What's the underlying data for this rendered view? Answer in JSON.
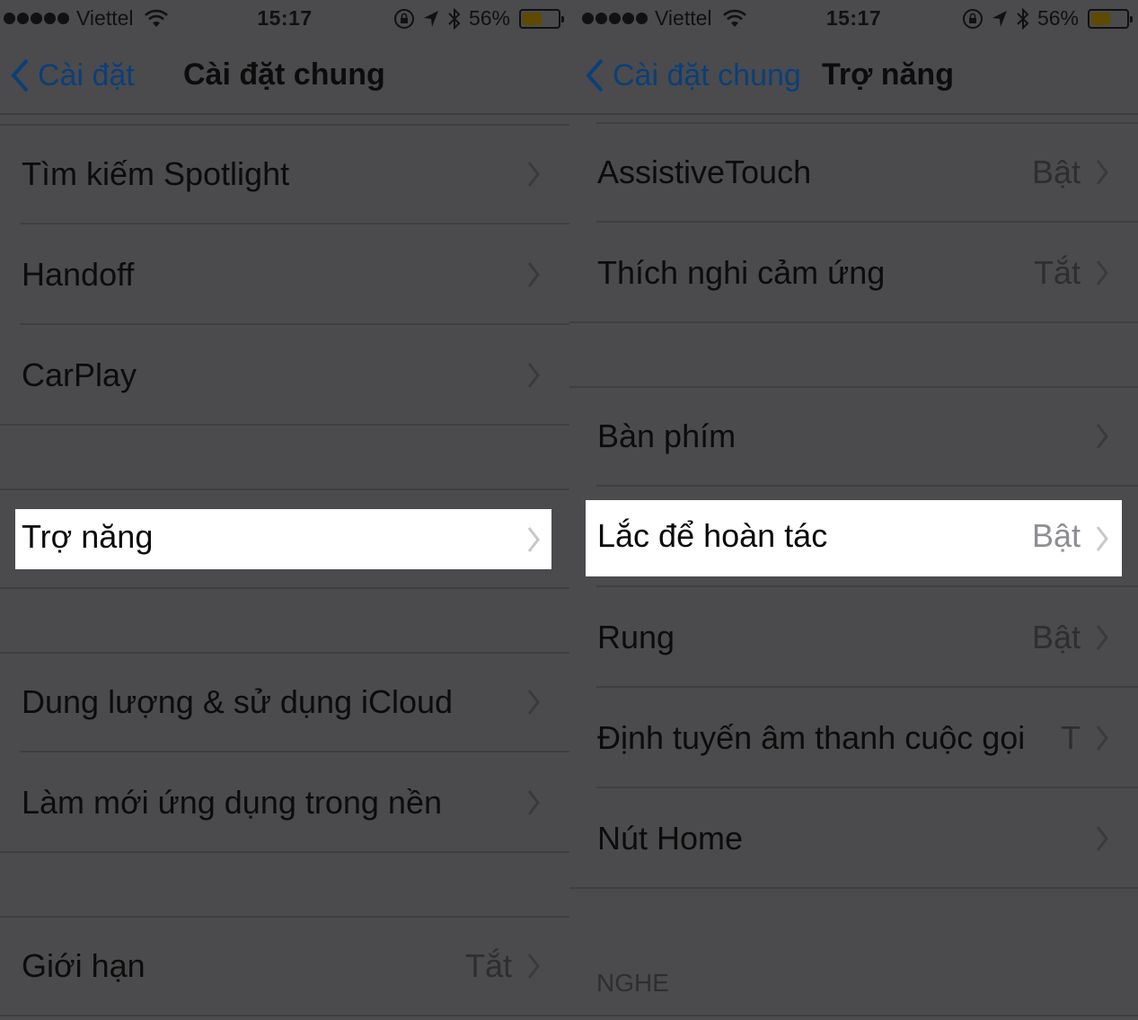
{
  "status_bar": {
    "carrier": "Viettel",
    "signal_bars": 5,
    "time": "15:17",
    "battery_percent_text": "56%",
    "battery_level": 0.56,
    "battery_color": "#5e4a00",
    "icons": [
      "signal-dots-icon",
      "wifi-icon",
      "rotation-lock-icon",
      "location-arrow-icon",
      "bluetooth-icon",
      "battery-icon"
    ]
  },
  "left_panel": {
    "back_label": "Cài đặt",
    "title": "Cài đặt chung",
    "groups": [
      {
        "items": [
          {
            "label": "Tìm kiếm Spotlight",
            "value": ""
          },
          {
            "label": "Handoff",
            "value": ""
          },
          {
            "label": "CarPlay",
            "value": ""
          }
        ]
      },
      {
        "items": [
          {
            "label": "Trợ năng",
            "value": "",
            "highlighted": true
          }
        ]
      },
      {
        "items": [
          {
            "label": "Dung lượng & sử dụng iCloud",
            "value": ""
          },
          {
            "label": "Làm mới ứng dụng trong nền",
            "value": ""
          }
        ]
      },
      {
        "items": [
          {
            "label": "Giới hạn",
            "value": "Tắt"
          }
        ]
      }
    ]
  },
  "right_panel": {
    "back_label": "Cài đặt chung",
    "title": "Trợ năng",
    "groups": [
      {
        "items": [
          {
            "label": "AssistiveTouch",
            "value": "Bật"
          },
          {
            "label": "Thích nghi cảm ứng",
            "value": "Tắt"
          }
        ]
      },
      {
        "items": [
          {
            "label": "Bàn phím",
            "value": ""
          },
          {
            "label": "Lắc để hoàn tác",
            "value": "Bật",
            "highlighted": true
          },
          {
            "label": "Rung",
            "value": "Bật"
          },
          {
            "label": "Định tuyến âm thanh cuộc gọi",
            "value": "T"
          },
          {
            "label": "Nút Home",
            "value": ""
          }
        ]
      }
    ],
    "section_header": "NGHE"
  },
  "colors": {
    "overlay_background": "#4b4b4d",
    "back_link": "#0b3f78",
    "highlight_background": "#ffffff"
  }
}
